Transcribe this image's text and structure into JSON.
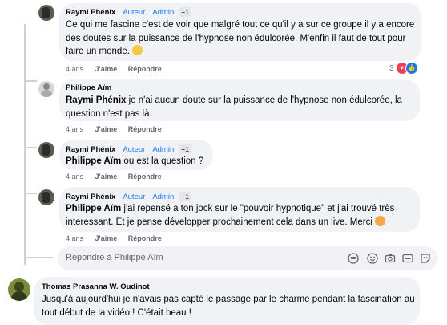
{
  "comments": [
    {
      "author": "Raymi Phénix",
      "role1": "Auteur",
      "role2": "Admin",
      "badge": "+1",
      "text": "Ce qui me fascine c'est de voir que malgré tout ce qu'il y a sur ce groupe il y a encore des doutes sur la puissance de l'hypnose non édulcorée. M'enfin il faut de tout pour faire un monde.",
      "time": "4 ans",
      "like": "J'aime",
      "reply": "Répondre",
      "reactions_count": "3"
    },
    {
      "author": "Philippe Aïm",
      "mention": "Raymi Phénix",
      "text": " je n'ai aucun doute sur la puissance de l'hypnose non édulcorée, la question n'est pas là.",
      "time": "4 ans",
      "like": "J'aime",
      "reply": "Répondre"
    },
    {
      "author": "Raymi Phénix",
      "role1": "Auteur",
      "role2": "Admin",
      "badge": "+1",
      "mention": "Philippe Aïm",
      "text": " ou est la question ?",
      "time": "4 ans",
      "like": "J'aime",
      "reply": "Répondre"
    },
    {
      "author": "Raymi Phénix",
      "role1": "Auteur",
      "role2": "Admin",
      "badge": "+1",
      "mention": "Philippe Aïm",
      "text": " j'ai repensé a ton jock sur le \"pouvoir hypnotique\" et j'ai trouvé très interessant. Et je pense développer prochainement cela dans un live. Merci",
      "time": "4 ans",
      "like": "J'aime",
      "reply": "Répondre"
    },
    {
      "author": "Thomas Prasanna W. Oudinot",
      "text": "Jusqu'à aujourd'hui je n'avais pas capté le passage par le charme pendant la fascination au tout début de la vidéo ! C'était beau !"
    }
  ],
  "reply_box": {
    "placeholder": "Répondre à Philippe Aïm"
  },
  "colors": {
    "accent": "#1877f2",
    "bubble": "#f0f2f5",
    "meta": "#65676b"
  }
}
